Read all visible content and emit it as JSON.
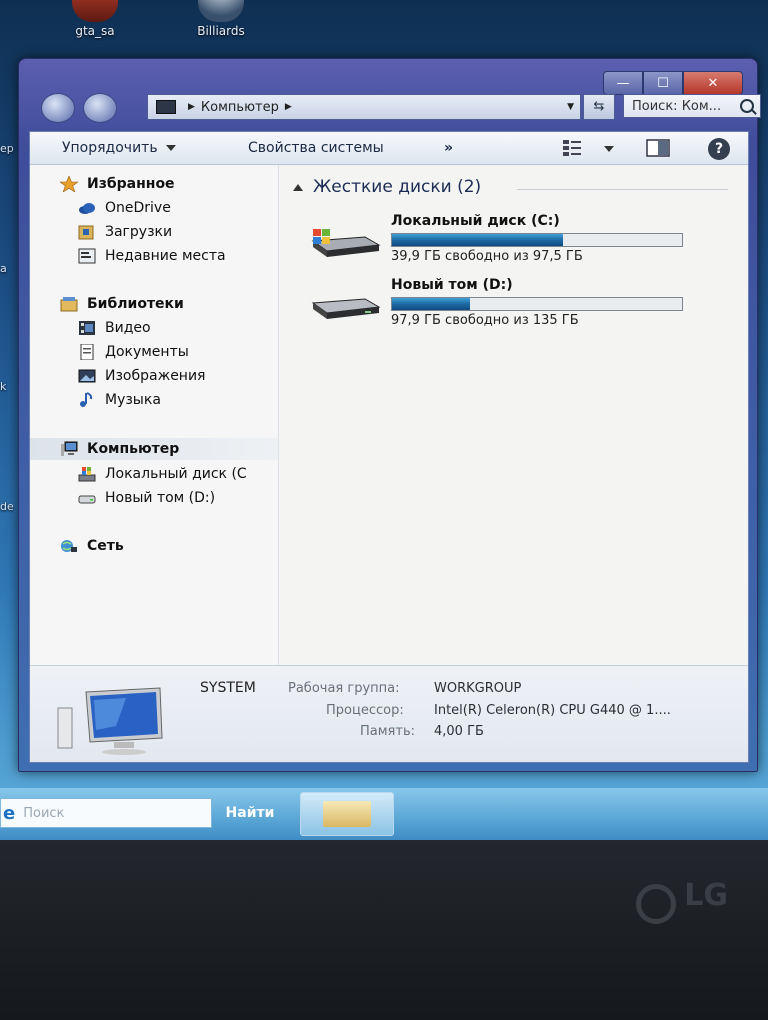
{
  "desktop": {
    "icons": [
      {
        "label": "gta_sa"
      },
      {
        "label": "Billiards"
      }
    ],
    "edge_glyphs": [
      "ер",
      "а",
      "k",
      "de"
    ]
  },
  "window": {
    "caption_buttons": {
      "minimize": "—",
      "maximize": "☐",
      "close": "✕"
    },
    "address": {
      "crumb": "Компьютер"
    },
    "search": {
      "placeholder": "Поиск: Ком..."
    },
    "toolbar": {
      "organize": "Упорядочить",
      "system_properties": "Свойства системы",
      "more": "»",
      "help": "?"
    },
    "nav": {
      "favorites": "Избранное",
      "onedrive": "OneDrive",
      "downloads": "Загрузки",
      "recent": "Недавние места",
      "libraries": "Библиотеки",
      "video": "Видео",
      "documents": "Документы",
      "pictures": "Изображения",
      "music": "Музыка",
      "computer": "Компьютер",
      "local_c": "Локальный диск (С",
      "new_volume_d": "Новый том (D:)",
      "network": "Сеть"
    },
    "main": {
      "group_title": "Жесткие диски (2)",
      "drives": [
        {
          "name": "Локальный диск (C:)",
          "free_text": "39,9 ГБ свободно из 97,5 ГБ",
          "used_fraction": 0.59
        },
        {
          "name": "Новый том (D:)",
          "free_text": "97,9 ГБ свободно из 135 ГБ",
          "used_fraction": 0.27
        }
      ]
    },
    "details": {
      "computer_name": "SYSTEM",
      "workgroup_label": "Рабочая группа:",
      "workgroup_value": "WORKGROUP",
      "cpu_label": "Процессор:",
      "cpu_value": "Intel(R) Celeron(R) CPU G440 @ 1....",
      "memory_label": "Память:",
      "memory_value": "4,00 ГБ"
    }
  },
  "taskbar": {
    "search_placeholder": "Поиск",
    "go_label": "Найти"
  },
  "monitor": {
    "brand": "LG"
  }
}
